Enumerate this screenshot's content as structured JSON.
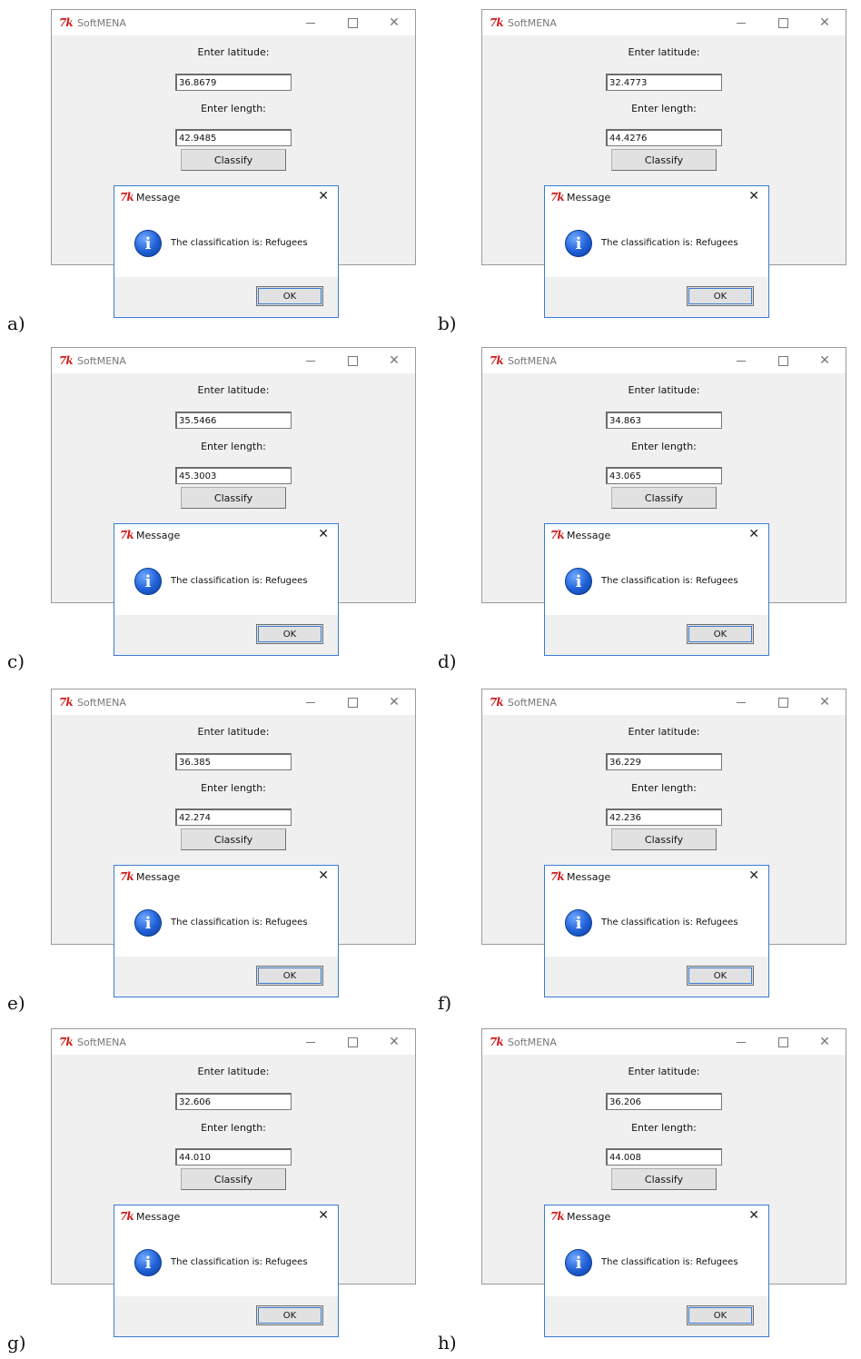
{
  "app_title": "SoftMENA",
  "tk_logo": "7k",
  "latitude_label": "Enter latitude:",
  "length_label": "Enter length:",
  "classify_label": "Classify",
  "dialog": {
    "title": "Message",
    "close": "✕",
    "icon": "info-icon",
    "icon_glyph": "i",
    "text": "The classification is: Refugees",
    "ok_label": "OK"
  },
  "window_controls": {
    "close": "✕"
  },
  "panels": [
    {
      "label": "a)",
      "latitude": "36.8679",
      "length": "42.9485"
    },
    {
      "label": "b)",
      "latitude": "32.4773",
      "length": "44.4276"
    },
    {
      "label": "c)",
      "latitude": "35.5466",
      "length": "45.3003"
    },
    {
      "label": "d)",
      "latitude": "34.863",
      "length": "43.065"
    },
    {
      "label": "e)",
      "latitude": "36.385",
      "length": "42.274"
    },
    {
      "label": "f)",
      "latitude": "36.229",
      "length": "42.236"
    },
    {
      "label": "g)",
      "latitude": "32.606",
      "length": "44.010"
    },
    {
      "label": "h)",
      "latitude": "36.206",
      "length": "44.008"
    }
  ]
}
